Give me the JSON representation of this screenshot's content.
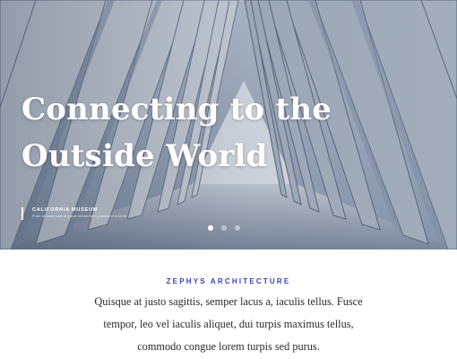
{
  "hero": {
    "title_line1": "Connecting to the",
    "title_line2": "Outside World",
    "caption_kicker": "CALIFORNIA MUSEUM",
    "caption_sub": "Proin sit amet nulla at ipsum elementum pulvinar et in tortor.",
    "carousel": {
      "slide_count": 3,
      "active_index": 0
    }
  },
  "intro": {
    "eyebrow": "ZEPHYS ARCHITECTURE",
    "paragraph": "Quisque at justo sagittis, semper lacus a, iaculis tellus. Fusce tempor, leo vel iaculis aliquet, dui turpis maximus tellus, commodo congue lorem turpis sed purus."
  },
  "colors": {
    "accent": "#3d3dc4",
    "text": "#2b2b2b",
    "hero_tint": "#9aa7b8"
  }
}
